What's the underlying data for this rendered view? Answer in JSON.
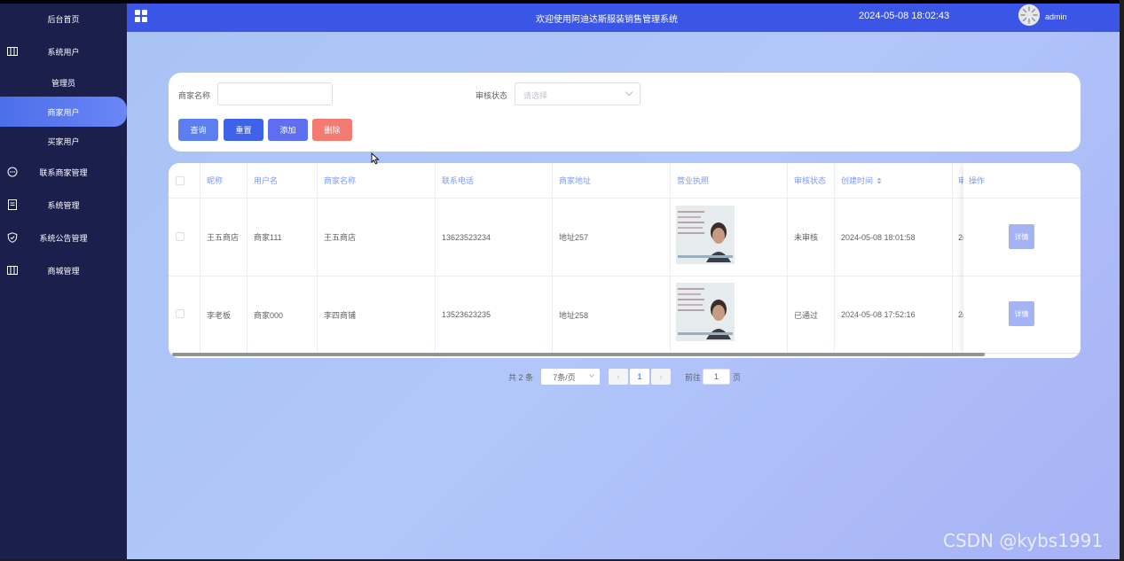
{
  "sidebar": {
    "items": [
      {
        "label": "后台首页",
        "icon": "none"
      },
      {
        "label": "系统用户",
        "icon": "columns-icon"
      },
      {
        "label": "管理员",
        "icon": "none"
      },
      {
        "label": "商家用户",
        "icon": "none",
        "active": true
      },
      {
        "label": "买家用户",
        "icon": "none"
      },
      {
        "label": "联系商家管理",
        "icon": "chat-icon"
      },
      {
        "label": "系统管理",
        "icon": "document-icon"
      },
      {
        "label": "系统公告管理",
        "icon": "shield-icon"
      },
      {
        "label": "商城管理",
        "icon": "columns-icon"
      }
    ]
  },
  "header": {
    "title": "欢迎使用阿迪达斯服装销售管理系统",
    "datetime": "2024-05-08 18:02:43",
    "username": "admin"
  },
  "search": {
    "merchant_name_label": "商家名称",
    "merchant_name_value": "",
    "audit_status_label": "审核状态",
    "audit_status_placeholder": "请选择",
    "buttons": {
      "query": "查询",
      "reset": "重置",
      "add": "添加",
      "delete": "删除"
    }
  },
  "table": {
    "columns": [
      "昵称",
      "用户名",
      "商家名称",
      "联系电话",
      "商家地址",
      "营业执照",
      "审核状态",
      "创建时间",
      "审",
      "操作"
    ],
    "rows": [
      {
        "nickname": "王五商店",
        "username": "商家111",
        "shop_name": "王五商店",
        "phone": "13623523234",
        "address": "地址257",
        "status": "未审核",
        "created": "2024-05-08 18:01:58",
        "cut": "2(",
        "action": "详情"
      },
      {
        "nickname": "李老板",
        "username": "商家000",
        "shop_name": "李四商铺",
        "phone": "13523623235",
        "address": "地址258",
        "status": "已通过",
        "created": "2024-05-08 17:52:16",
        "cut": "2(",
        "action": "详情"
      }
    ]
  },
  "pagination": {
    "total": "共 2 条",
    "page_size": "7条/页",
    "current_page": "1",
    "goto_label": "前往",
    "goto_value": "1",
    "page_suffix": "页"
  },
  "watermark": "CSDN @kybs1991",
  "colors": {
    "sidebar_bg": "#1a1f4c",
    "header_bg": "#3b56e6",
    "btn_query": "#5b7ff0",
    "btn_reset": "#3f63e8",
    "btn_add": "#5d6ff0",
    "btn_delete": "#f47b72",
    "header_text": "#7b9af5"
  }
}
